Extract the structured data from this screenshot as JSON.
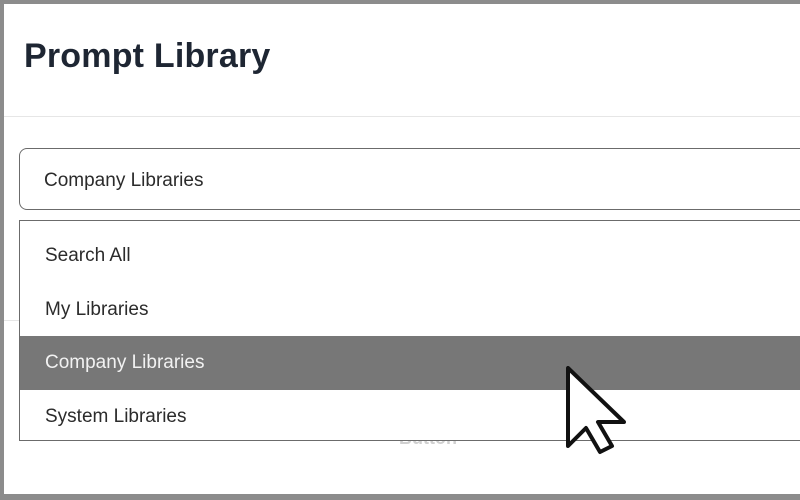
{
  "header": {
    "title": "Prompt Library"
  },
  "library_select": {
    "selected_value": "Company Libraries",
    "options": [
      {
        "label": "Search All"
      },
      {
        "label": "My Libraries"
      },
      {
        "label": "Company Libraries"
      },
      {
        "label": "System Libraries"
      }
    ],
    "selected_index": 2
  },
  "background": {
    "button_partial_text": "Button"
  },
  "icons": {
    "cursor": "mouse-pointer-icon"
  },
  "colors": {
    "selected_option_bg": "#777777",
    "title_text": "#1e2633"
  }
}
